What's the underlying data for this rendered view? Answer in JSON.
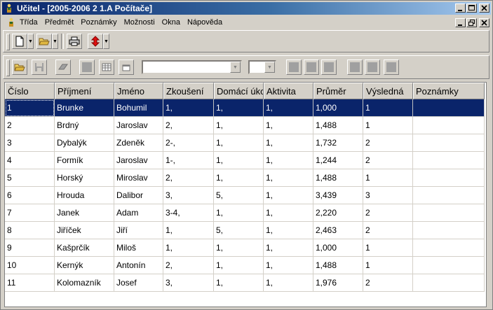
{
  "window": {
    "title": "Učitel - [2005-2006 2 1.A Počítače]"
  },
  "menu": [
    "Třída",
    "Předmět",
    "Poznámky",
    "Možnosti",
    "Okna",
    "Nápověda"
  ],
  "icons": {
    "app": "teacher-figure-icon",
    "new": "new-document-icon",
    "open": "open-folder-icon",
    "print": "printer-icon",
    "special": "red-arrow-icon"
  },
  "colors": {
    "title_start": "#0a246a",
    "title_end": "#a6caf0",
    "selection": "#0a246a"
  },
  "table": {
    "headers": [
      "Číslo",
      "Příjmení",
      "Jméno",
      "Zkoušení",
      "Domácí úkoly",
      "Aktivita",
      "Průměr",
      "Výsledná",
      "Poznámky"
    ],
    "rows": [
      [
        "1",
        "Brunke",
        "Bohumil",
        "1,",
        "1,",
        "1,",
        "1,000",
        "1",
        ""
      ],
      [
        "2",
        "Brdný",
        "Jaroslav",
        "2,",
        "1,",
        "1,",
        "1,488",
        "1",
        ""
      ],
      [
        "3",
        "Dybalýk",
        "Zdeněk",
        "2-,",
        "1,",
        "1,",
        "1,732",
        "2",
        ""
      ],
      [
        "4",
        "Formík",
        "Jaroslav",
        "1-,",
        "1,",
        "1,",
        "1,244",
        "2",
        ""
      ],
      [
        "5",
        "Horský",
        "Miroslav",
        "2,",
        "1,",
        "1,",
        "1,488",
        "1",
        ""
      ],
      [
        "6",
        "Hrouda",
        "Dalibor",
        "3,",
        "5,",
        "1,",
        "3,439",
        "3",
        ""
      ],
      [
        "7",
        "Janek",
        "Adam",
        "3-4,",
        "1,",
        "1,",
        "2,220",
        "2",
        ""
      ],
      [
        "8",
        "Jiříček",
        "Jiří",
        "1,",
        "5,",
        "1,",
        "2,463",
        "2",
        ""
      ],
      [
        "9",
        "Kašprčík",
        "Miloš",
        "1,",
        "1,",
        "1,",
        "1,000",
        "1",
        ""
      ],
      [
        "10",
        "Kernýk",
        "Antonín",
        "2,",
        "1,",
        "1,",
        "1,488",
        "1",
        ""
      ],
      [
        "11",
        "Kolomazník",
        "Josef",
        "3,",
        "1,",
        "1,",
        "1,976",
        "2",
        ""
      ]
    ],
    "selected_row": 0
  }
}
